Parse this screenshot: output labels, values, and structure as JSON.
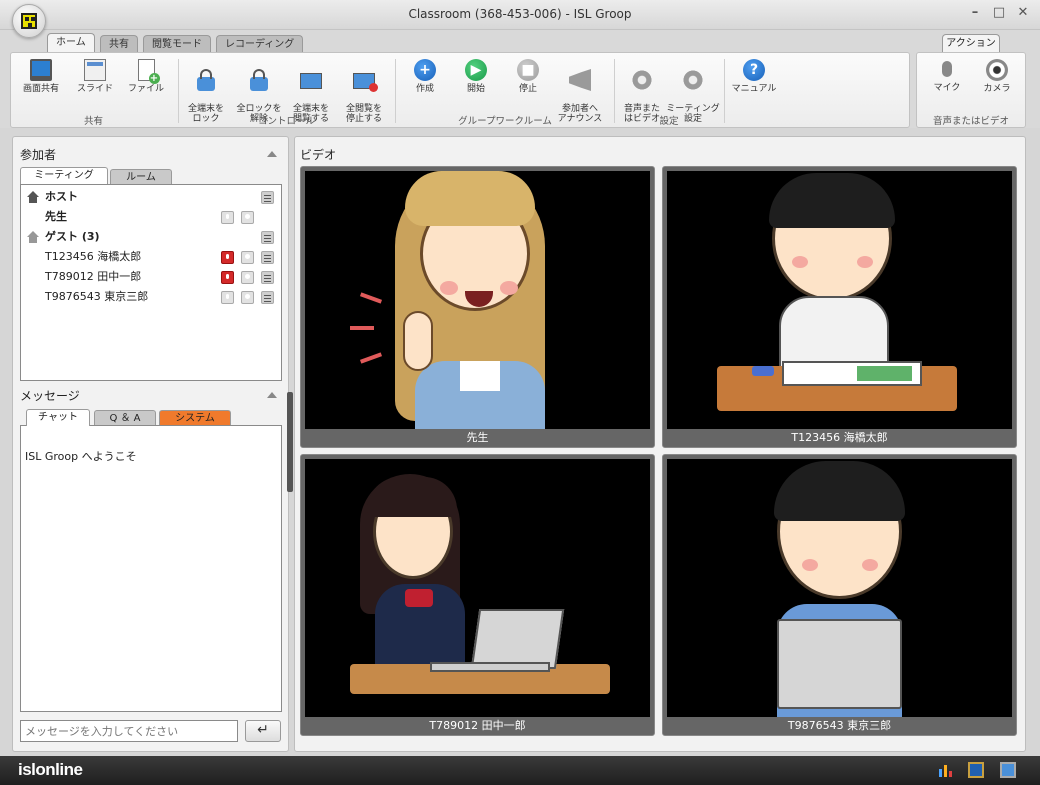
{
  "window": {
    "title": "Classroom (368-453-006) - ISL Groop"
  },
  "tabs": [
    {
      "label": "ホーム",
      "active": true
    },
    {
      "label": "共有",
      "active": false
    },
    {
      "label": "閲覧モード",
      "active": false
    },
    {
      "label": "レコーディング",
      "active": false
    }
  ],
  "action_tab": {
    "label": "アクション"
  },
  "ribbon": {
    "share": {
      "group": "共有",
      "screen_share": "画面共有",
      "slide": "スライド",
      "file": "ファイル"
    },
    "control": {
      "group": "コントロール",
      "lock_all": "全端末を\nロック",
      "unlock_all": "全ロックを\n解除",
      "open_all": "全端末を\n閲覧する",
      "stop_all": "全閲覧を\n停止する"
    },
    "groupwork": {
      "group": "グループワークルーム",
      "create": "作成",
      "start": "開始",
      "stop": "停止",
      "announce": "参加者へ\nアナウンス"
    },
    "settings": {
      "group": "設定",
      "av": "音声また\nはビデオ",
      "meeting": "ミーティング\n設定",
      "manual": "マニュアル"
    },
    "actions": {
      "group": "音声またはビデオ",
      "mic": "マイク",
      "camera": "カメラ"
    }
  },
  "participants": {
    "title": "参加者",
    "tabs": [
      "ミーティング",
      "ルーム"
    ],
    "host_label": "ホスト",
    "host_name": "先生",
    "guest_label": "ゲスト (3)",
    "guests": [
      {
        "name": "T123456 海橋太郎",
        "mic_active": true
      },
      {
        "name": "T789012 田中一郎",
        "mic_active": true
      },
      {
        "name": "T9876543 東京三郎",
        "mic_active": false
      }
    ]
  },
  "messages": {
    "title": "メッセージ",
    "tabs": [
      "チャット",
      "Q ＆ A",
      "システム"
    ],
    "welcome": "ISL Groop へようこそ",
    "input_placeholder": "メッセージを入力してください",
    "send_glyph": "↵"
  },
  "video": {
    "title": "ビデオ",
    "tiles": [
      {
        "label": "先生"
      },
      {
        "label": "T123456 海橋太郎"
      },
      {
        "label": "T789012 田中一郎"
      },
      {
        "label": "T9876543 東京三郎"
      }
    ]
  },
  "statusbar": {
    "brand": "islonline"
  },
  "colors": {
    "accent_orange": "#f07a2c",
    "mic_red": "#d42a2a",
    "video_bg": "#000000"
  },
  "icons": [
    "monitor-icon",
    "slide-icon",
    "file-add-icon",
    "lock-icon",
    "unlock-icon",
    "screen-view-icon",
    "screen-stop-icon",
    "plus-icon",
    "play-icon",
    "stop-icon",
    "megaphone-icon",
    "gear-icon",
    "help-icon",
    "mic-icon",
    "camera-icon"
  ]
}
